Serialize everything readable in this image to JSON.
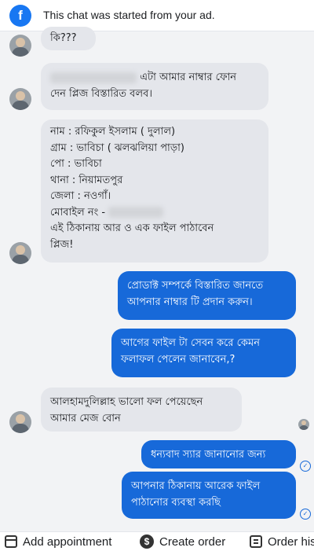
{
  "banner": {
    "icon": "facebook-icon",
    "text": "This chat was started from your ad."
  },
  "messages": [
    {
      "dir": "in",
      "text": "কি???"
    },
    {
      "dir": "in",
      "redacted_prefix": true,
      "text": " এটা আমার নাম্বার ফোন\nদেন প্লিজ বিস্তারিত বলব।"
    },
    {
      "dir": "in",
      "lines": [
        "নাম : রফিকুল ইসলাম ( দুলাল)",
        "গ্রাম : ভাবিচা ( ঝলঝলিয়া পাড়া)",
        "পো : ভাবিচা",
        "থানা : নিয়ামতপুর",
        "জেলা : নওগাঁ।",
        "মোবাইল নং -",
        "এই ঠিকানায়  আর ও এক ফাইল পাঠাবেন",
        "প্লিজ!"
      ]
    },
    {
      "dir": "out",
      "text": "প্রোডাক্ট সম্পর্কে বিস্তারিত জানতে\nআপনার নাম্বার টি প্রদান করুন।"
    },
    {
      "dir": "out",
      "text": "আগের ফাইল টা সেবন করে কেমন\nফলাফল পেলেন জানাবেন,?"
    },
    {
      "dir": "in",
      "text": "আলহামদুলিল্লাহ ভালো  ফল পেয়েছেন\nআমার মেজ বোন"
    },
    {
      "dir": "out",
      "text": "ধন্যবাদ স্যার জানানোর জন্য"
    },
    {
      "dir": "out",
      "text": "আপনার ঠিকানায় আরেক ফাইল\nপাঠানোর ব্যবস্থা করছি"
    }
  ],
  "actions": [
    {
      "icon": "calendar-icon",
      "label": "Add appointment"
    },
    {
      "icon": "dollar-icon",
      "label": "Create order"
    },
    {
      "icon": "list-icon",
      "label": "Order his"
    }
  ]
}
